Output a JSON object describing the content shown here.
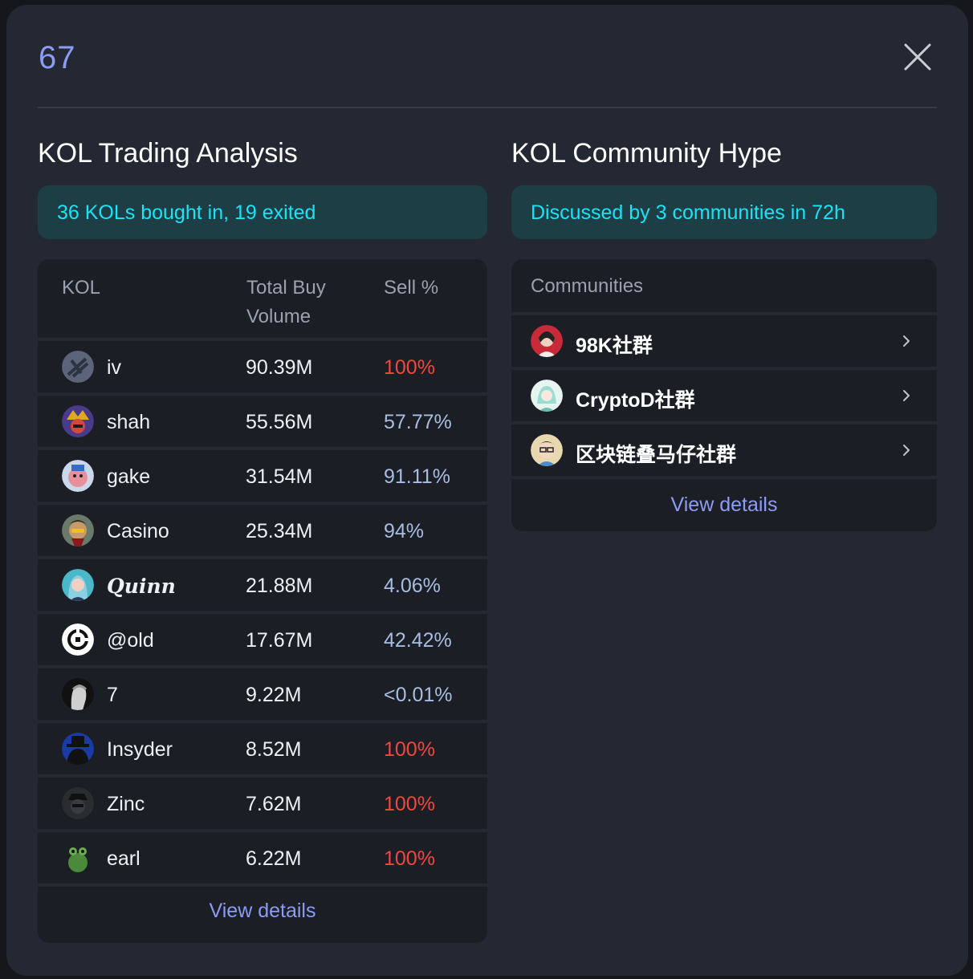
{
  "modal": {
    "title": "67"
  },
  "trading": {
    "title": "KOL Trading Analysis",
    "summary": "36 KOLs bought in, 19 exited",
    "columns": {
      "kol": "KOL",
      "volume_line1": "Total Buy",
      "volume_line2": "Volume",
      "sell": "Sell %"
    },
    "rows": [
      {
        "name": "iv",
        "volume": "90.39M",
        "sell": "100%",
        "sell_color": "red",
        "avatar": "avatar-iv"
      },
      {
        "name": "shah",
        "volume": "55.56M",
        "sell": "57.77%",
        "sell_color": "blue",
        "avatar": "avatar-shah"
      },
      {
        "name": "gake",
        "volume": "31.54M",
        "sell": "91.11%",
        "sell_color": "blue",
        "avatar": "avatar-gake"
      },
      {
        "name": "Casino",
        "volume": "25.34M",
        "sell": "94%",
        "sell_color": "blue",
        "avatar": "avatar-casino"
      },
      {
        "name": "Quinn",
        "volume": "21.88M",
        "sell": "4.06%",
        "sell_color": "blue",
        "avatar": "avatar-quinn"
      },
      {
        "name": "@old",
        "volume": "17.67M",
        "sell": "42.42%",
        "sell_color": "blue",
        "avatar": "avatar-old"
      },
      {
        "name": "7",
        "volume": "9.22M",
        "sell": "<0.01%",
        "sell_color": "blue",
        "avatar": "avatar-7"
      },
      {
        "name": "Insyder",
        "volume": "8.52M",
        "sell": "100%",
        "sell_color": "red",
        "avatar": "avatar-insyder"
      },
      {
        "name": "Zinc",
        "volume": "7.62M",
        "sell": "100%",
        "sell_color": "red",
        "avatar": "avatar-zinc"
      },
      {
        "name": "earl",
        "volume": "6.22M",
        "sell": "100%",
        "sell_color": "red",
        "avatar": "avatar-earl"
      }
    ],
    "view_details": "View details"
  },
  "community": {
    "title": "KOL Community Hype",
    "summary": "Discussed by 3 communities in 72h",
    "header": "Communities",
    "rows": [
      {
        "name": "98K社群",
        "avatar": "avatar-98k"
      },
      {
        "name": "CryptoD社群",
        "avatar": "avatar-cryptod"
      },
      {
        "name": "区块链叠马仔社群",
        "avatar": "avatar-blockchain"
      }
    ],
    "view_details": "View details"
  },
  "colors": {
    "accent": "#8c9cf6",
    "cyan": "#19e3f4",
    "sell_red": "#f2473c",
    "sell_blue": "#a8bde0",
    "panel_bg": "#242833",
    "card_bg": "#1b1e25"
  }
}
